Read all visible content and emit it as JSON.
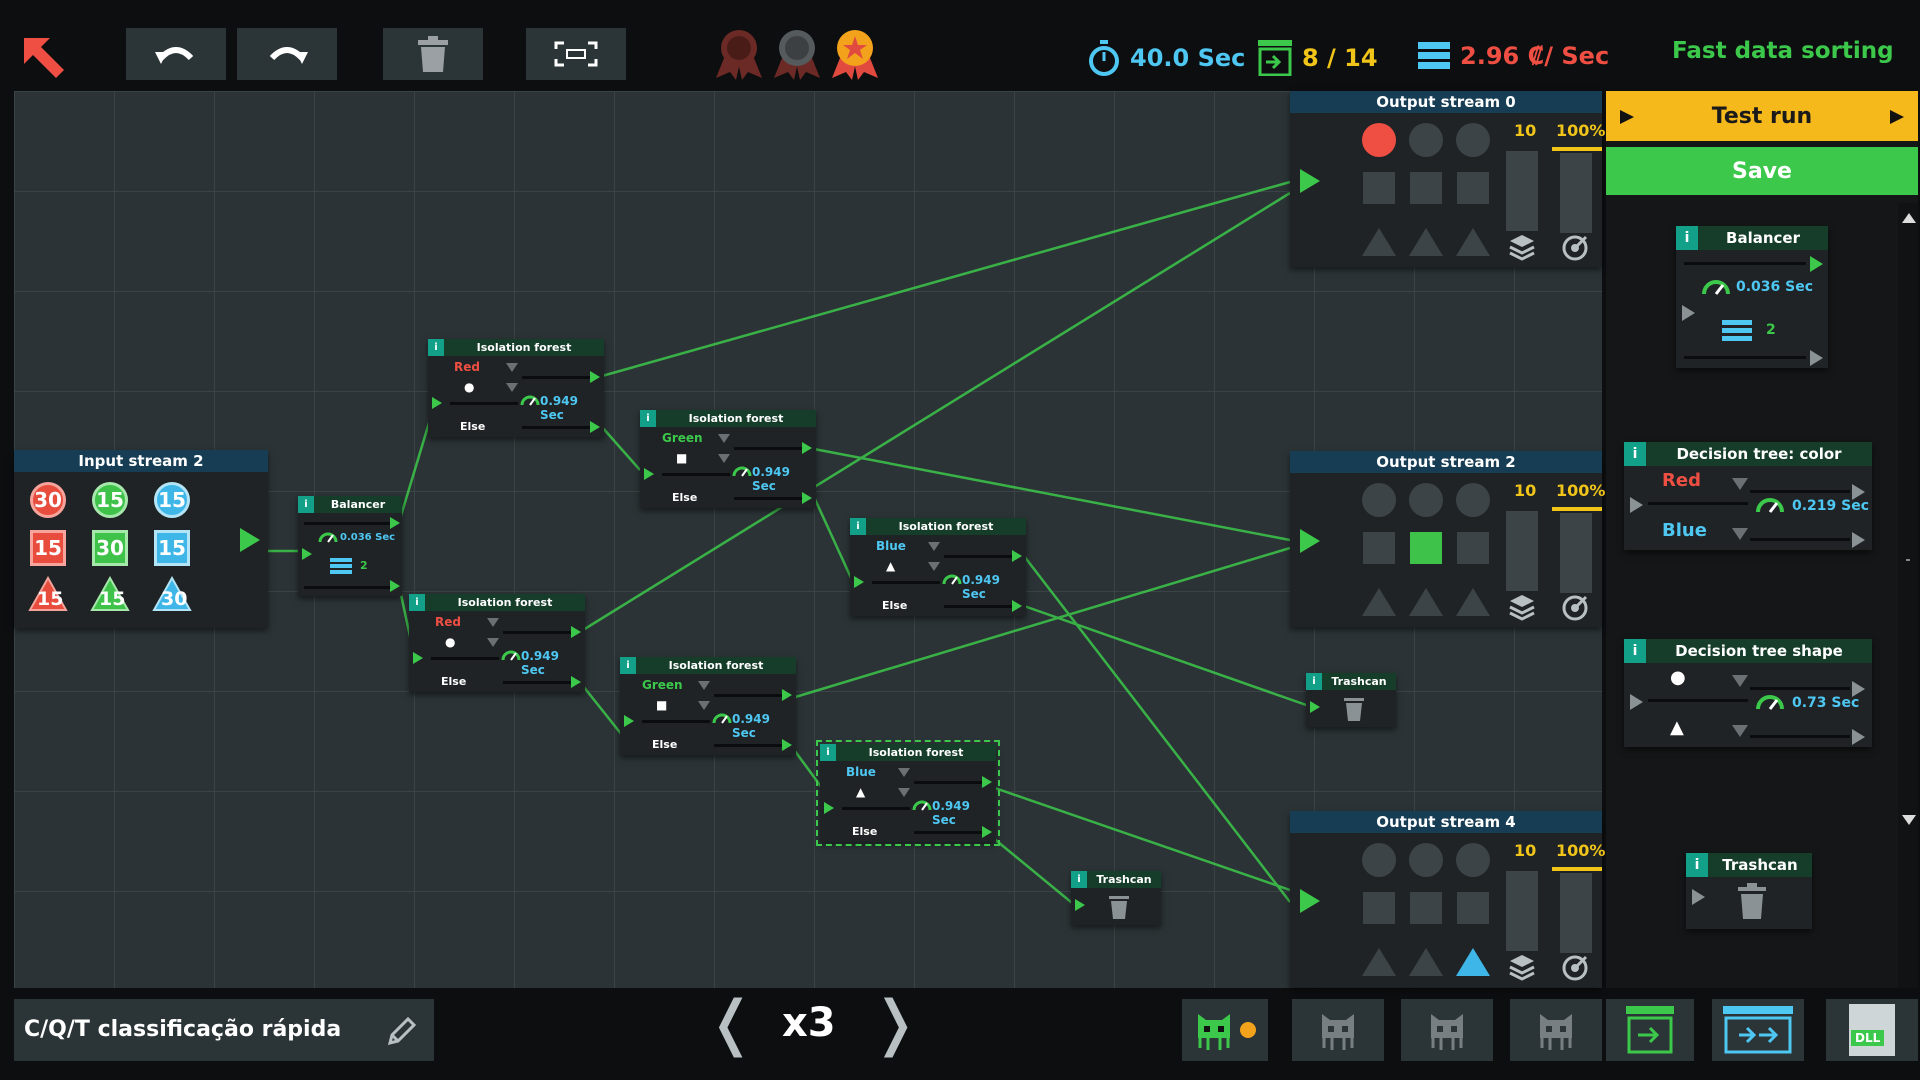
{
  "toolbar": {
    "back_icon": "arrow-up-left-icon",
    "undo_icon": "undo-icon",
    "redo_icon": "redo-icon",
    "delete_icon": "trash-icon",
    "fit_icon": "fit-view-icon",
    "medals": [
      "bronze-medal-icon",
      "silver-medal-icon",
      "gold-medal-icon"
    ]
  },
  "stats": {
    "time": "40.0 Sec",
    "count": "8 / 14",
    "cost": "2.96 ₡/ Sec",
    "level_title": "Fast data sorting"
  },
  "input_stream": {
    "title": "Input stream 2",
    "items": [
      {
        "shape": "circle",
        "color": "#e74c3c",
        "value": "30"
      },
      {
        "shape": "circle",
        "color": "#3ec24a",
        "value": "15"
      },
      {
        "shape": "circle",
        "color": "#3fb6e8",
        "value": "15"
      },
      {
        "shape": "square",
        "color": "#e74c3c",
        "value": "15"
      },
      {
        "shape": "square",
        "color": "#3ec24a",
        "value": "30"
      },
      {
        "shape": "square",
        "color": "#3fb6e8",
        "value": "15"
      },
      {
        "shape": "triangle",
        "color": "#e74c3c",
        "value": "15"
      },
      {
        "shape": "triangle",
        "color": "#3ec24a",
        "value": "15"
      },
      {
        "shape": "triangle",
        "color": "#3fb6e8",
        "value": "30"
      }
    ]
  },
  "nodes": {
    "balancer": {
      "title": "Balancer",
      "speed": "0.036 Sec",
      "count": "2"
    },
    "if1": {
      "title": "Isolation forest",
      "color": "Red",
      "shape": "●",
      "speed": "0.949 Sec",
      "else": "Else"
    },
    "if2": {
      "title": "Isolation forest",
      "color": "Green",
      "shape": "■",
      "speed": "0.949 Sec",
      "else": "Else"
    },
    "if3": {
      "title": "Isolation forest",
      "color": "Blue",
      "shape": "▲",
      "speed": "0.949 Sec",
      "else": "Else"
    },
    "if4": {
      "title": "Isolation forest",
      "color": "Red",
      "shape": "●",
      "speed": "0.949 Sec",
      "else": "Else"
    },
    "if5": {
      "title": "Isolation forest",
      "color": "Green",
      "shape": "■",
      "speed": "0.949 Sec",
      "else": "Else"
    },
    "if6": {
      "title": "Isolation forest",
      "color": "Blue",
      "shape": "▲",
      "speed": "0.949 Sec",
      "else": "Else"
    },
    "trash1": {
      "title": "Trashcan"
    },
    "trash2": {
      "title": "Trashcan"
    }
  },
  "outputs": [
    {
      "title": "Output stream 0",
      "count": "10",
      "percent": "100%",
      "active": "red-circle"
    },
    {
      "title": "Output stream 2",
      "count": "10",
      "percent": "100%",
      "active": "green-square"
    },
    {
      "title": "Output stream 4",
      "count": "10",
      "percent": "100%",
      "active": "blue-triangle"
    }
  ],
  "panel": {
    "test_run": "Test run",
    "save": "Save",
    "balancer": {
      "title": "Balancer",
      "speed": "0.036 Sec",
      "count": "2"
    },
    "dt_color": {
      "title": "Decision tree: color",
      "opt1": "Red",
      "opt2": "Blue",
      "speed": "0.219 Sec"
    },
    "dt_shape": {
      "title": "Decision tree shape",
      "opt1": "●",
      "opt2": "▲",
      "speed": "0.73 Sec"
    },
    "trash": {
      "title": "Trashcan"
    }
  },
  "footer": {
    "project_name": "C/Q/T classificação rápida",
    "speed": "x3",
    "prev": "❬",
    "next": "❭",
    "robots": [
      "robot-icon",
      "robot-icon",
      "robot-icon",
      "robot-icon"
    ],
    "tabs": [
      "import-icon",
      "export-icon",
      "DLL"
    ]
  },
  "colors": {
    "accent_green": "#3cc84a",
    "cyan": "#4ec7f2",
    "yellow": "#f0c419",
    "red": "#ef4f43"
  }
}
